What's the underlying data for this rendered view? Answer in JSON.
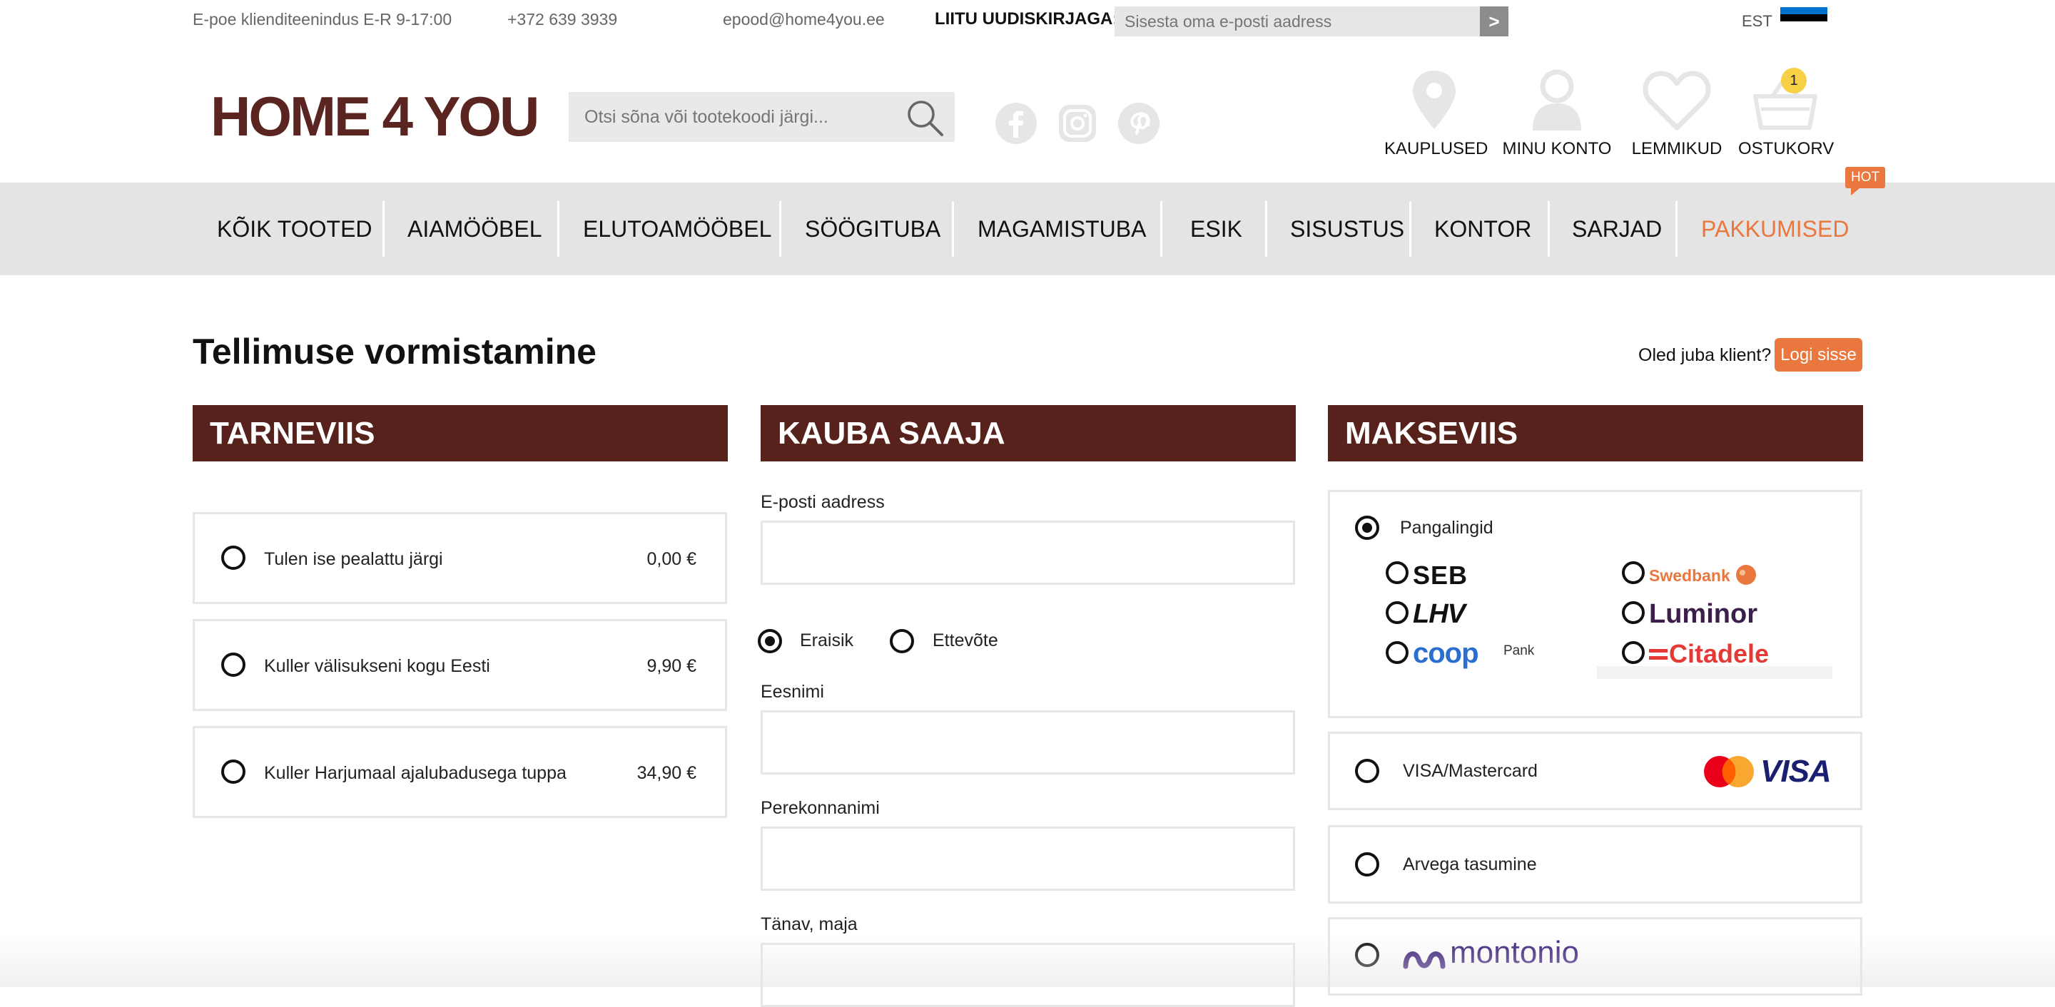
{
  "topbar": {
    "service_hours": "E-poe klienditeenindus E-R 9-17:00",
    "phone": "+372 639 3939",
    "email": "epood@home4you.ee",
    "newsletter_label": "LIITU UUDISKIRJAGA:",
    "newsletter_placeholder": "Sisesta oma e-posti aadress",
    "newsletter_button": ">",
    "language": "EST",
    "flag_colors": [
      "#0072ce",
      "#000000",
      "#ffffff"
    ]
  },
  "header": {
    "logo": "HOME 4 YOU",
    "search_placeholder": "Otsi sõna või tootekoodi järgi...",
    "social_icons": [
      "facebook-icon",
      "instagram-icon",
      "pinterest-icon"
    ],
    "stores_label": "KAUPLUSED",
    "account_label": "MINU KONTO",
    "favorites_label": "LEMMIKUD",
    "cart_label": "OSTUKORV",
    "cart_count": "1"
  },
  "nav": {
    "items": [
      "KÕIK TOOTED",
      "AIAMÖÖBEL",
      "ELUTOAMÖÖBEL",
      "SÖÖGITUBA",
      "MAGAMISTUBA",
      "ESIK",
      "SISUSTUS",
      "KONTOR",
      "SARJAD",
      "PAKKUMISED"
    ],
    "hot_badge": "HOT",
    "promo_color": "#e9773e"
  },
  "page": {
    "title": "Tellimuse vormistamine",
    "already_client": "Oled juba klient?",
    "login_button": "Logi sisse",
    "accent_color": "#57221c"
  },
  "delivery": {
    "heading": "TARNEVIIS",
    "options": [
      {
        "label": "Tulen ise pealattu järgi",
        "price": "0,00 €"
      },
      {
        "label": "Kuller välisukseni kogu Eesti",
        "price": "9,90 €"
      },
      {
        "label": "Kuller Harjumaal ajalubadusega tuppa",
        "price": "34,90 €"
      }
    ]
  },
  "recipient": {
    "heading": "KAUBA SAAJA",
    "email_label": "E-posti aadress",
    "type_private": "Eraisik",
    "type_company": "Ettevõte",
    "selected_type": "Eraisik",
    "first_name_label": "Eesnimi",
    "last_name_label": "Perekonnanimi",
    "street_label": "Tänav, maja"
  },
  "payment": {
    "heading": "MAKSEVIIS",
    "bank_links_label": "Pangalingid",
    "banks": [
      "SEB",
      "Swedbank",
      "LHV",
      "Luminor",
      "coop",
      "Pank",
      "Citadele"
    ],
    "card_label": "VISA/Mastercard",
    "visa_text": "VISA",
    "invoice_label": "Arvega tasumine",
    "montonio_label": "montonio"
  }
}
